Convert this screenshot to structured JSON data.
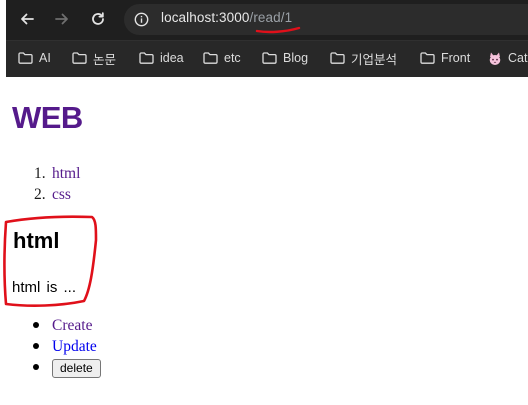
{
  "browser": {
    "url_host": "localhost:3000",
    "url_path": "/read/1",
    "bookmarks": [
      {
        "label": "AI"
      },
      {
        "label": "논문"
      },
      {
        "label": "idea"
      },
      {
        "label": "etc"
      },
      {
        "label": "Blog"
      },
      {
        "label": "기업분석"
      },
      {
        "label": "Front"
      },
      {
        "label": "Cat"
      }
    ]
  },
  "page": {
    "title": "WEB",
    "toc": [
      {
        "num": "1.",
        "label": "html"
      },
      {
        "num": "2.",
        "label": "css"
      }
    ],
    "article": {
      "title": "html",
      "body": "html is ..."
    },
    "controls": {
      "create": "Create",
      "update": "Update",
      "delete": "delete"
    }
  },
  "colors": {
    "visited_link": "#551a8b",
    "unvisited_link": "#0000ee",
    "annotation": "#e0101a"
  }
}
